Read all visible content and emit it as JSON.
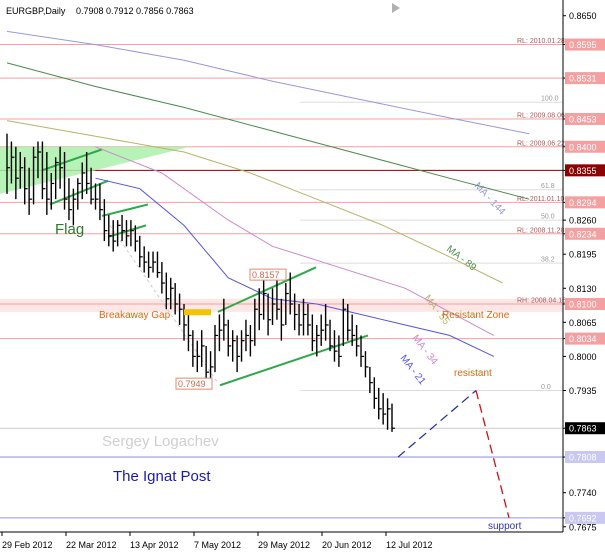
{
  "header": {
    "symbol": "EURGBP,Daily",
    "ohlc": "0.7908 0.7912 0.7856 0.7863",
    "close_icon": "close-icon"
  },
  "watermark": "Sergey Logachev",
  "colors": {
    "bar": "#000000",
    "ma144": "#9999dd",
    "ma89": "#4b8a4b",
    "ma55": "#b5b56a",
    "ma34": "#cc88cc",
    "ma21": "#5555dd",
    "level_line": "#f4a0a0",
    "pattern": "#2fa84a",
    "flag_fill": "#aaf0aa",
    "projection_up": "#1a2aa0",
    "projection_down": "#cc1111",
    "breakaway": "#f2c400",
    "annotation_text": "#dd6611",
    "support_line": "#a9a9ee"
  },
  "chart_data": {
    "type": "ohlc",
    "title": "EURGBP,Daily",
    "ylim": [
      0.7665,
      0.868
    ],
    "grid": false,
    "y_ticks": [
      "0.8650",
      "0.8595",
      "0.8531",
      "0.8453",
      "0.8400",
      "0.8355",
      "0.8294",
      "0.8260",
      "0.8234",
      "0.8195",
      "0.8130",
      "0.8100",
      "0.8065",
      "0.8034",
      "0.8000",
      "0.7935",
      "0.7863",
      "0.7808",
      "0.7740",
      "0.7692",
      "0.7675"
    ],
    "x_ticks": [
      "29 Feb 2012",
      "22 Mar 2012",
      "13 Apr 2012",
      "7 May 2012",
      "29 May 2012",
      "20 Jun 2012",
      "12 Jul 2012"
    ],
    "current_price": "0.8355",
    "last_price": "0.7863",
    "moving_averages": [
      {
        "name": "MA - 144",
        "label": "MA - 144",
        "points": [
          [
            0.0,
            0.862
          ],
          [
            20,
            0.8595
          ],
          [
            40,
            0.8565
          ],
          [
            60,
            0.8525
          ],
          [
            80,
            0.849
          ],
          [
            100,
            0.8455
          ],
          [
            118,
            0.8425
          ]
        ]
      },
      {
        "name": "MA - 89",
        "label": "MA - 89",
        "points": [
          [
            0.0,
            0.856
          ],
          [
            20,
            0.8515
          ],
          [
            40,
            0.8475
          ],
          [
            60,
            0.843
          ],
          [
            80,
            0.8385
          ],
          [
            100,
            0.834
          ],
          [
            118,
            0.83
          ]
        ]
      },
      {
        "name": "MA - 55",
        "label": "MA - 55",
        "points": [
          [
            0.0,
            0.845
          ],
          [
            20,
            0.842
          ],
          [
            40,
            0.839
          ],
          [
            55,
            0.835
          ],
          [
            70,
            0.83
          ],
          [
            85,
            0.825
          ],
          [
            100,
            0.819
          ],
          [
            112,
            0.814
          ]
        ]
      },
      {
        "name": "MA - 34",
        "label": "MA - 34",
        "points": [
          [
            20,
            0.84
          ],
          [
            35,
            0.835
          ],
          [
            50,
            0.826
          ],
          [
            60,
            0.821
          ],
          [
            75,
            0.817
          ],
          [
            90,
            0.813
          ],
          [
            100,
            0.8085
          ],
          [
            110,
            0.804
          ]
        ]
      },
      {
        "name": "MA - 21",
        "label": "MA - 21",
        "points": [
          [
            20,
            0.834
          ],
          [
            30,
            0.832
          ],
          [
            40,
            0.825
          ],
          [
            50,
            0.815
          ],
          [
            60,
            0.811
          ],
          [
            70,
            0.81
          ],
          [
            80,
            0.808
          ],
          [
            90,
            0.806
          ],
          [
            100,
            0.804
          ],
          [
            110,
            0.8
          ]
        ]
      }
    ],
    "levels": [
      {
        "name": "RL 2010.01.28",
        "value": 0.8595,
        "label": "RL: 2010.01.28"
      },
      {
        "name": "0.8531",
        "value": 0.8531,
        "label": ""
      },
      {
        "name": "100.0",
        "value": 0.8485,
        "label": "100.0"
      },
      {
        "name": "RL 2009.08.06",
        "value": 0.8453,
        "label": "RL: 2009.08.06"
      },
      {
        "name": "RL 2009.06.22",
        "value": 0.84,
        "label": "RL: 2009.06.22"
      },
      {
        "name": "0.8355",
        "value": 0.8355,
        "label": ""
      },
      {
        "name": "61.8",
        "value": 0.8318,
        "label": "61.8"
      },
      {
        "name": "RL 2011.01.10",
        "value": 0.8294,
        "label": "RL: 2011.01.10"
      },
      {
        "name": "50.0",
        "value": 0.826,
        "label": "50.0"
      },
      {
        "name": "RL 2008.11.28",
        "value": 0.8234,
        "label": "RL: 2008.11.28"
      },
      {
        "name": "38.2",
        "value": 0.8178,
        "label": "38.2"
      },
      {
        "name": "RH 2008.04.16",
        "value": 0.81,
        "label": "RH: 2008.04.16"
      },
      {
        "name": "0.8034",
        "value": 0.8034,
        "label": ""
      },
      {
        "name": "0.0",
        "value": 0.7935,
        "label": "0.0"
      },
      {
        "name": "0.7863",
        "value": 0.7863,
        "label": ""
      },
      {
        "name": "0.7808",
        "value": 0.7808,
        "label": ""
      },
      {
        "name": "0.7692",
        "value": 0.7692,
        "label": ""
      }
    ],
    "annotations": {
      "flag": "Flag",
      "breakaway_gap": "Breakaway Gap",
      "resistant_zone": "Resistant Zone",
      "resistant": "resistant",
      "support": "support",
      "ignat_post": "The Ignat Post",
      "box_high": "0.8157",
      "box_low": "0.7949"
    },
    "bars": [
      [
        0.8425,
        0.831,
        0.836
      ],
      [
        0.841,
        0.833,
        0.838
      ],
      [
        0.84,
        0.83,
        0.834
      ],
      [
        0.839,
        0.832,
        0.836
      ],
      [
        0.838,
        0.829,
        0.832
      ],
      [
        0.836,
        0.827,
        0.83
      ],
      [
        0.84,
        0.829,
        0.838
      ],
      [
        0.841,
        0.834,
        0.839
      ],
      [
        0.841,
        0.83,
        0.832
      ],
      [
        0.839,
        0.827,
        0.83
      ],
      [
        0.835,
        0.828,
        0.833
      ],
      [
        0.838,
        0.83,
        0.837
      ],
      [
        0.84,
        0.832,
        0.836
      ],
      [
        0.839,
        0.828,
        0.83
      ],
      [
        0.834,
        0.826,
        0.828
      ],
      [
        0.832,
        0.825,
        0.83
      ],
      [
        0.834,
        0.828,
        0.833
      ],
      [
        0.837,
        0.83,
        0.835
      ],
      [
        0.839,
        0.831,
        0.833
      ],
      [
        0.836,
        0.829,
        0.83
      ],
      [
        0.833,
        0.828,
        0.83
      ],
      [
        0.833,
        0.826,
        0.828
      ],
      [
        0.83,
        0.822,
        0.824
      ],
      [
        0.827,
        0.821,
        0.823
      ],
      [
        0.826,
        0.82,
        0.822
      ],
      [
        0.826,
        0.821,
        0.825
      ],
      [
        0.827,
        0.822,
        0.824
      ],
      [
        0.826,
        0.821,
        0.823
      ],
      [
        0.826,
        0.821,
        0.824
      ],
      [
        0.825,
        0.82,
        0.822
      ],
      [
        0.823,
        0.817,
        0.819
      ],
      [
        0.821,
        0.816,
        0.818
      ],
      [
        0.82,
        0.815,
        0.817
      ],
      [
        0.82,
        0.816,
        0.818
      ],
      [
        0.82,
        0.815,
        0.816
      ],
      [
        0.818,
        0.812,
        0.814
      ],
      [
        0.816,
        0.809,
        0.811
      ],
      [
        0.815,
        0.809,
        0.813
      ],
      [
        0.814,
        0.808,
        0.81
      ],
      [
        0.812,
        0.806,
        0.809
      ],
      [
        0.81,
        0.803,
        0.806
      ],
      [
        0.808,
        0.801,
        0.804
      ],
      [
        0.805,
        0.798,
        0.8
      ],
      [
        0.803,
        0.797,
        0.8
      ],
      [
        0.805,
        0.798,
        0.802
      ],
      [
        0.802,
        0.795,
        0.797
      ],
      [
        0.801,
        0.7949,
        0.798
      ],
      [
        0.806,
        0.797,
        0.804
      ],
      [
        0.808,
        0.801,
        0.805
      ],
      [
        0.811,
        0.803,
        0.806
      ],
      [
        0.807,
        0.8,
        0.802
      ],
      [
        0.805,
        0.799,
        0.803
      ],
      [
        0.804,
        0.797,
        0.8
      ],
      [
        0.805,
        0.799,
        0.803
      ],
      [
        0.807,
        0.801,
        0.804
      ],
      [
        0.806,
        0.8,
        0.803
      ],
      [
        0.811,
        0.802,
        0.809
      ],
      [
        0.813,
        0.805,
        0.808
      ],
      [
        0.8157,
        0.807,
        0.812
      ],
      [
        0.812,
        0.804,
        0.807
      ],
      [
        0.813,
        0.806,
        0.81
      ],
      [
        0.815,
        0.807,
        0.809
      ],
      [
        0.811,
        0.803,
        0.806
      ],
      [
        0.814,
        0.806,
        0.812
      ],
      [
        0.816,
        0.808,
        0.81
      ],
      [
        0.812,
        0.805,
        0.808
      ],
      [
        0.81,
        0.804,
        0.806
      ],
      [
        0.811,
        0.804,
        0.808
      ],
      [
        0.81,
        0.804,
        0.806
      ],
      [
        0.808,
        0.801,
        0.803
      ],
      [
        0.806,
        0.8,
        0.804
      ],
      [
        0.808,
        0.802,
        0.805
      ],
      [
        0.81,
        0.803,
        0.806
      ],
      [
        0.807,
        0.801,
        0.802
      ],
      [
        0.805,
        0.799,
        0.801
      ],
      [
        0.804,
        0.798,
        0.8
      ],
      [
        0.811,
        0.802,
        0.809
      ],
      [
        0.81,
        0.803,
        0.805
      ],
      [
        0.808,
        0.802,
        0.804
      ],
      [
        0.806,
        0.8,
        0.802
      ],
      [
        0.804,
        0.798,
        0.8
      ],
      [
        0.801,
        0.796,
        0.798
      ],
      [
        0.798,
        0.793,
        0.795
      ],
      [
        0.796,
        0.79,
        0.792
      ],
      [
        0.794,
        0.788,
        0.79
      ],
      [
        0.793,
        0.787,
        0.789
      ],
      [
        0.792,
        0.786,
        0.79
      ],
      [
        0.791,
        0.7856,
        0.7863
      ]
    ]
  }
}
